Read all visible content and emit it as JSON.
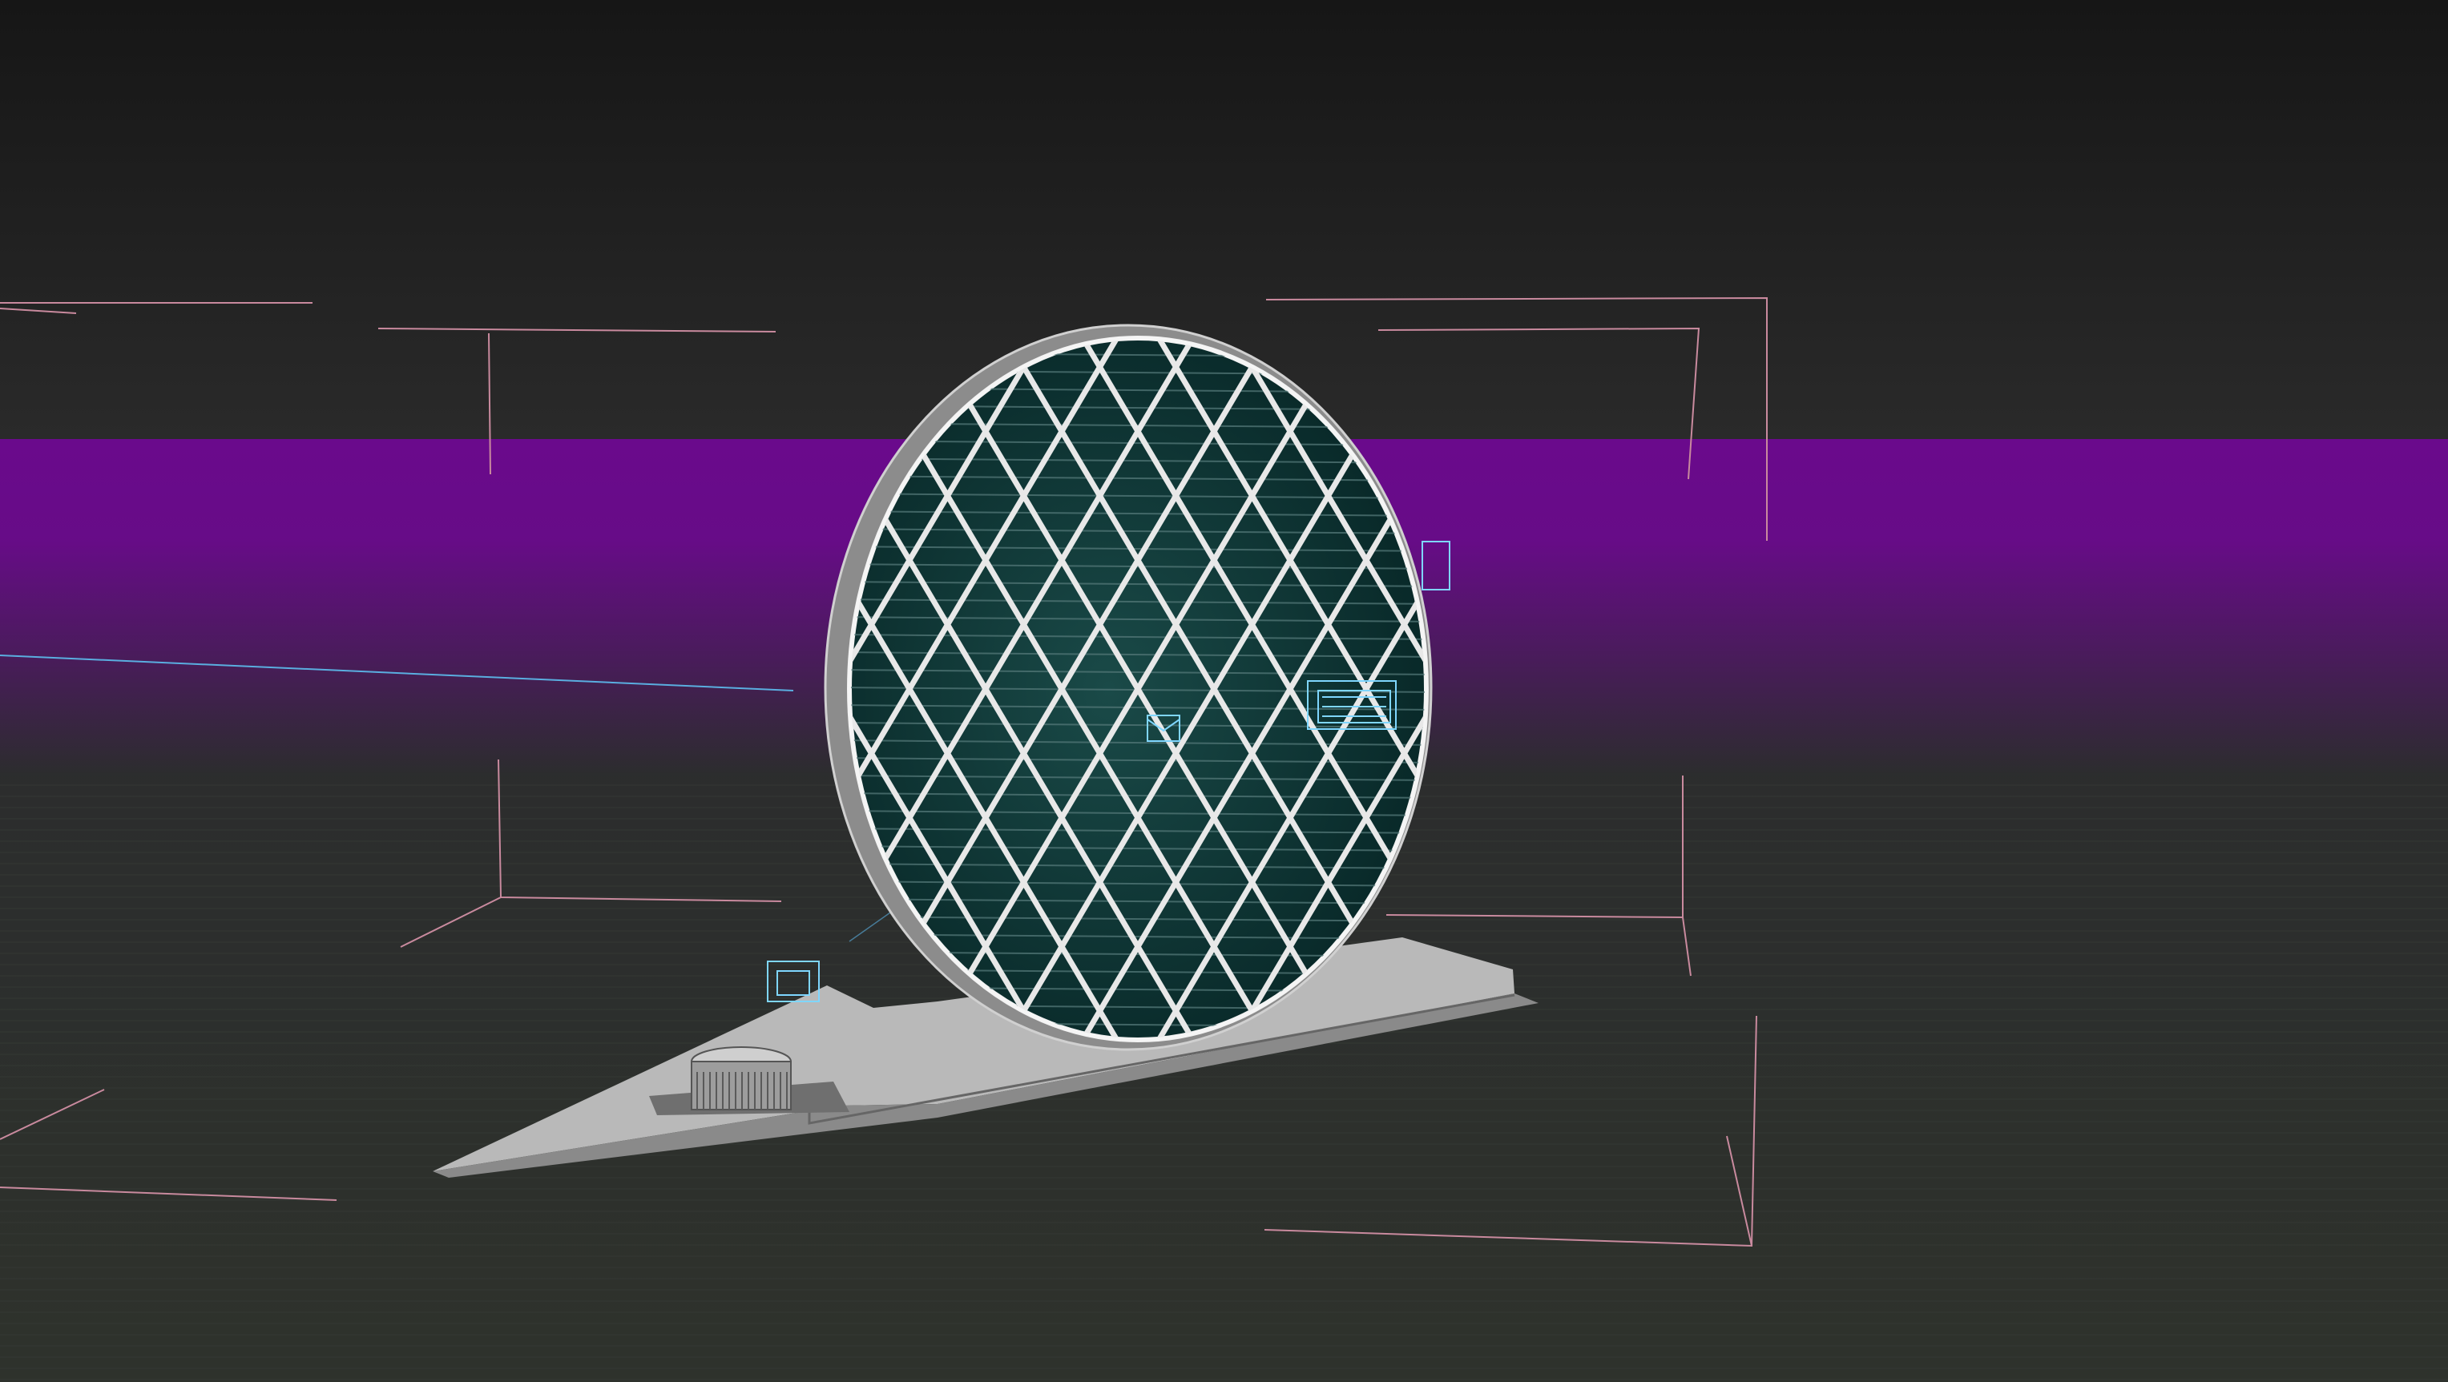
{
  "viewport": {
    "active_border_color": "#b8b46a",
    "sky_top_color": "#161616",
    "sky_bottom_color": "#2a2a2a",
    "backdrop_band_color": "#6a0a8c",
    "ground_color": "#2c2f2b",
    "bracket_color": "#c98a9e",
    "helper_color": "#5aaee0",
    "light_helper_color": "#7fd6ff",
    "building_edge_color": "#e8e8e8",
    "building_glass_color": "#0d3a3a",
    "podium_color": "#b9b9b9"
  },
  "scene": {
    "object": "circular-diagrid-tower-wireframe",
    "selected": true
  }
}
